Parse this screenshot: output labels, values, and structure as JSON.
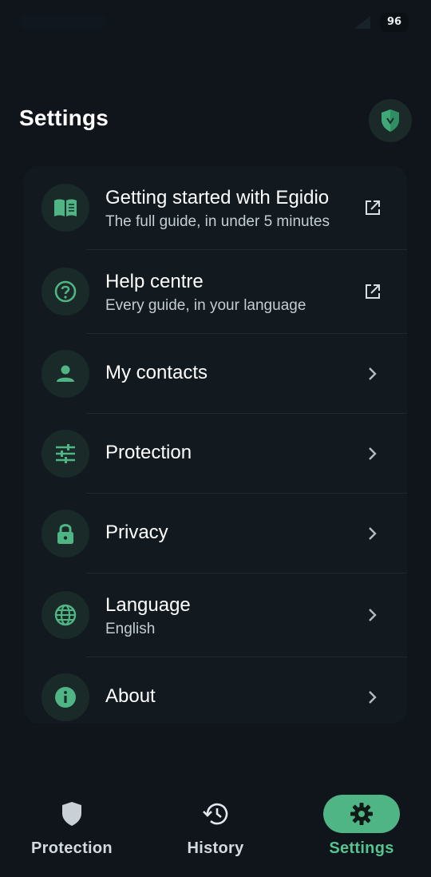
{
  "status_bar": {
    "battery": "96"
  },
  "header": {
    "title": "Settings",
    "shield_icon": "shield-icon"
  },
  "colors": {
    "accent": "#4fb585",
    "background": "#0f151b",
    "card": "#121a20"
  },
  "menu": [
    {
      "icon": "book-icon",
      "label": "Getting started with Egidio",
      "subtitle": "The full guide, in under 5 minutes",
      "trailing": "external-link-icon"
    },
    {
      "icon": "help-circle-icon",
      "label": "Help centre",
      "subtitle": "Every guide, in your language",
      "trailing": "external-link-icon"
    },
    {
      "icon": "person-icon",
      "label": "My contacts",
      "subtitle": "",
      "trailing": "chevron-right-icon"
    },
    {
      "icon": "sliders-icon",
      "label": "Protection",
      "subtitle": "",
      "trailing": "chevron-right-icon"
    },
    {
      "icon": "lock-icon",
      "label": "Privacy",
      "subtitle": "",
      "trailing": "chevron-right-icon"
    },
    {
      "icon": "globe-icon",
      "label": "Language",
      "subtitle": "English",
      "trailing": "chevron-right-icon"
    },
    {
      "icon": "info-icon",
      "label": "About",
      "subtitle": "",
      "trailing": "chevron-right-icon"
    }
  ],
  "bottom_nav": [
    {
      "label": "Protection",
      "icon": "shield-icon",
      "active": false
    },
    {
      "label": "History",
      "icon": "history-icon",
      "active": false
    },
    {
      "label": "Settings",
      "icon": "gear-icon",
      "active": true
    }
  ]
}
